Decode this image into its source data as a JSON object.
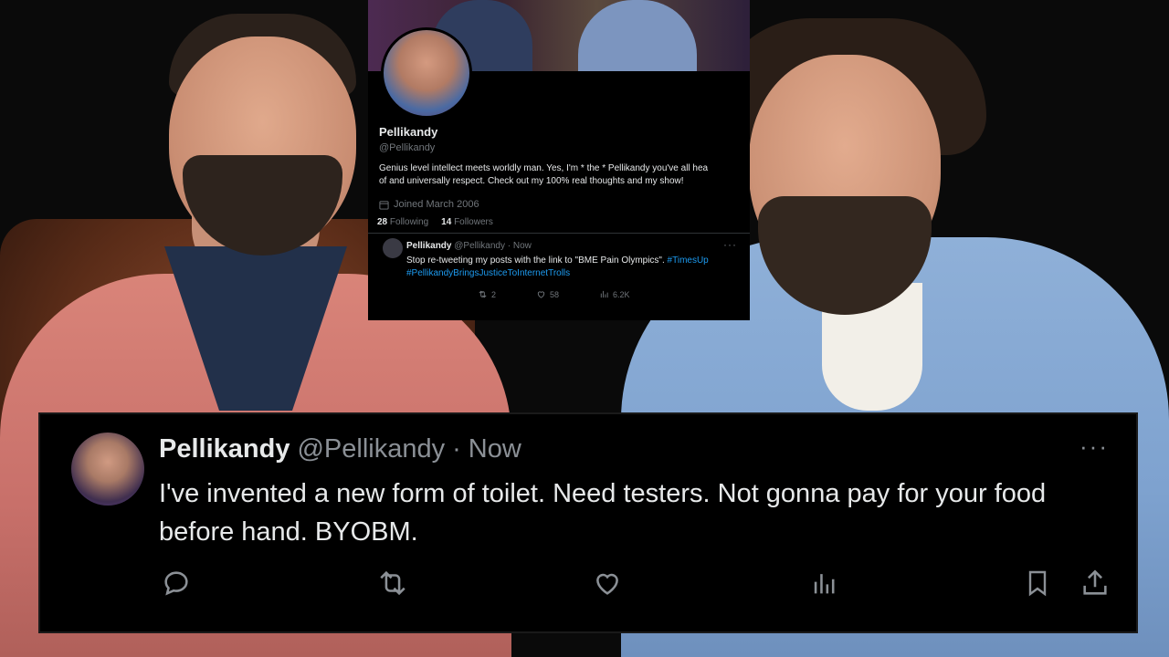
{
  "profile": {
    "name": "Pellikandy",
    "handle": "@Pellikandy",
    "bio_line1": "Genius level intellect meets worldly man. Yes, I'm * the * Pellikandy you've all hea",
    "bio_line2": "of and universally respect. Check out my 100% real thoughts and my show!",
    "joined": "Joined March 2006",
    "following_count": "28",
    "following_label": "Following",
    "followers_count": "14",
    "followers_label": "Followers"
  },
  "small_tweet": {
    "name": "Pellikandy",
    "handle": "@Pellikandy",
    "dot": "·",
    "time": "Now",
    "text": "Stop re-tweeting my posts with the link to \"BME Pain Olympics\".",
    "tag1": "#TimesUp",
    "tag2": "#PellikandyBringsJusticeToInternetTrolls",
    "retweets": "2",
    "likes": "58",
    "views": "6.2K",
    "more": "···"
  },
  "main_tweet": {
    "name": "Pellikandy",
    "handle": "@Pellikandy",
    "dot": "·",
    "time": "Now",
    "text": "I've invented a new form of toilet. Need testers. Not gonna pay for your food before hand.  BYOBM.",
    "more": "···"
  },
  "icons": [
    "calendar-icon",
    "reply-icon",
    "retweet-icon",
    "like-icon",
    "views-icon",
    "bookmark-icon",
    "share-icon",
    "more-icon"
  ],
  "colors": {
    "background": "#000000",
    "text": "#e7e9ea",
    "muted": "#71767b",
    "link": "#1d9bf0"
  }
}
